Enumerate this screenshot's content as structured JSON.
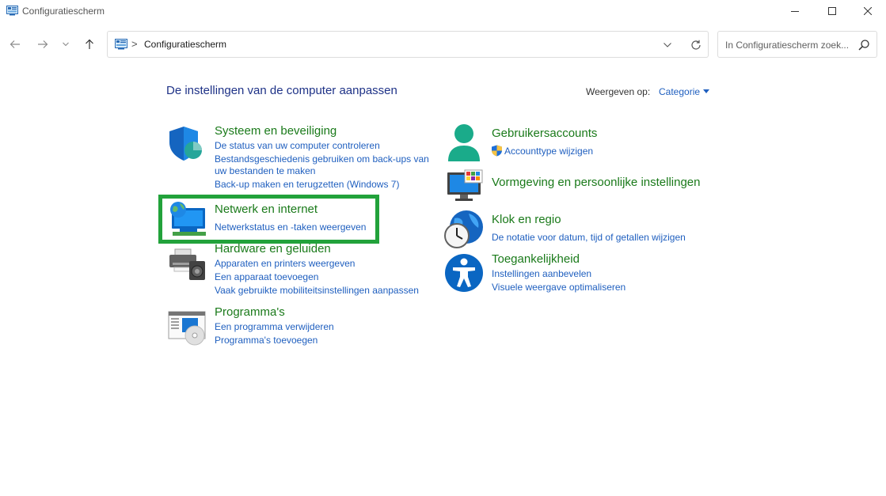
{
  "window": {
    "title": "Configuratiescherm"
  },
  "address": {
    "path": "Configuratiescherm",
    "separator": ">"
  },
  "search": {
    "placeholder": "In Configuratiescherm zoek..."
  },
  "content": {
    "heading": "De instellingen van de computer aanpassen",
    "view_label": "Weergeven op:",
    "view_value": "Categorie"
  },
  "categories_left": [
    {
      "title": "Systeem en beveiliging",
      "links": [
        "De status van uw computer controleren",
        "Bestandsgeschiedenis gebruiken om back-ups van",
        "uw bestanden te maken",
        "Back-up maken en terugzetten (Windows 7)"
      ],
      "icon": "shield-icon"
    },
    {
      "title": "Netwerk en internet",
      "links": [
        "Netwerkstatus en -taken weergeven"
      ],
      "icon": "network-globe-icon"
    },
    {
      "title": "Hardware en geluiden",
      "links": [
        "Apparaten en printers weergeven",
        "Een apparaat toevoegen",
        "Vaak gebruikte mobiliteitsinstellingen aanpassen"
      ],
      "icon": "printer-speaker-icon"
    },
    {
      "title": "Programma's",
      "links": [
        "Een programma verwijderen",
        "Programma's toevoegen"
      ],
      "icon": "programs-disc-icon"
    }
  ],
  "categories_right": [
    {
      "title": "Gebruikersaccounts",
      "links": [
        "Accounttype wijzigen"
      ],
      "icon": "user-accounts-icon"
    },
    {
      "title": "Vormgeving en persoonlijke instellingen",
      "links": [],
      "icon": "monitor-palette-icon"
    },
    {
      "title": "Klok en regio",
      "links": [
        "De notatie voor datum, tijd of getallen wijzigen"
      ],
      "icon": "clock-globe-icon"
    },
    {
      "title": "Toegankelijkheid",
      "links": [
        "Instellingen aanbevelen",
        "Visuele weergave optimaliseren"
      ],
      "icon": "accessibility-icon"
    }
  ],
  "colors": {
    "category_title": "#1a7a1a",
    "link": "#1f5fbf",
    "heading": "#1e3287",
    "highlight": "#22a23b"
  }
}
